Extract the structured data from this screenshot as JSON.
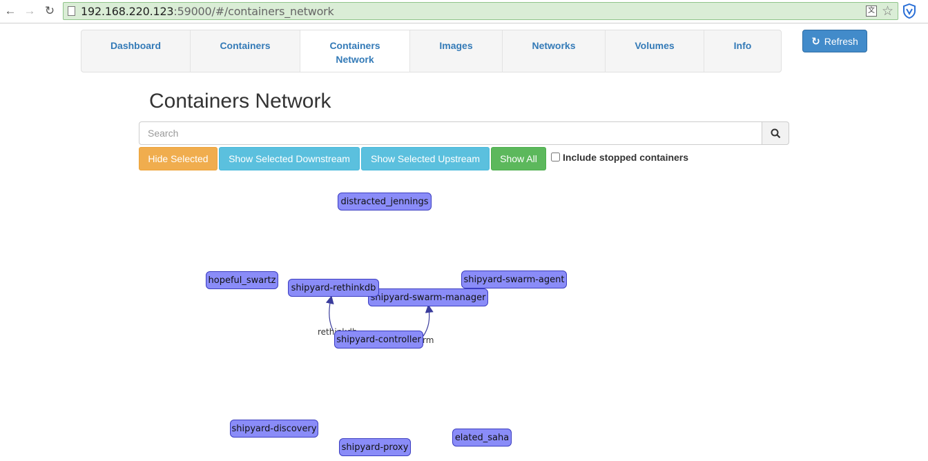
{
  "browser": {
    "url_host": "192.168.220.123",
    "url_rest": ":59000/#/containers_network"
  },
  "nav": {
    "items": [
      {
        "label": "Dashboard"
      },
      {
        "label": "Containers"
      },
      {
        "label": "Containers Network",
        "active": true
      },
      {
        "label": "Images"
      },
      {
        "label": "Networks"
      },
      {
        "label": "Volumes"
      },
      {
        "label": "Info"
      }
    ]
  },
  "refresh": {
    "label": "Refresh",
    "icon": "refresh-icon"
  },
  "page": {
    "title": "Containers Network"
  },
  "search": {
    "placeholder": "Search",
    "value": ""
  },
  "actions": {
    "hide_selected": "Hide Selected",
    "show_downstream": "Show Selected Downstream",
    "show_upstream": "Show Selected Upstream",
    "show_all": "Show All",
    "include_stopped": "Include stopped containers",
    "include_stopped_checked": false
  },
  "graph": {
    "nodes": [
      {
        "name": "distracted_jennings"
      },
      {
        "name": "hopeful_swartz"
      },
      {
        "name": "shipyard-rethinkdb"
      },
      {
        "name": "shipyard-swarm-manager"
      },
      {
        "name": "shipyard-swarm-agent"
      },
      {
        "name": "shipyard-controller"
      },
      {
        "name": "shipyard-discovery"
      },
      {
        "name": "shipyard-proxy"
      },
      {
        "name": "elated_saha"
      }
    ],
    "edges": [
      {
        "from": "shipyard-controller",
        "to": "shipyard-rethinkdb",
        "label": "rethinkdb"
      },
      {
        "from": "shipyard-controller",
        "to": "shipyard-swarm-manager",
        "label": "swarm"
      }
    ],
    "edge_labels_visible": [
      "rethinkdb",
      "rm"
    ],
    "node_color": "#8a8cf8",
    "edge_color": "#3a3c9c"
  }
}
